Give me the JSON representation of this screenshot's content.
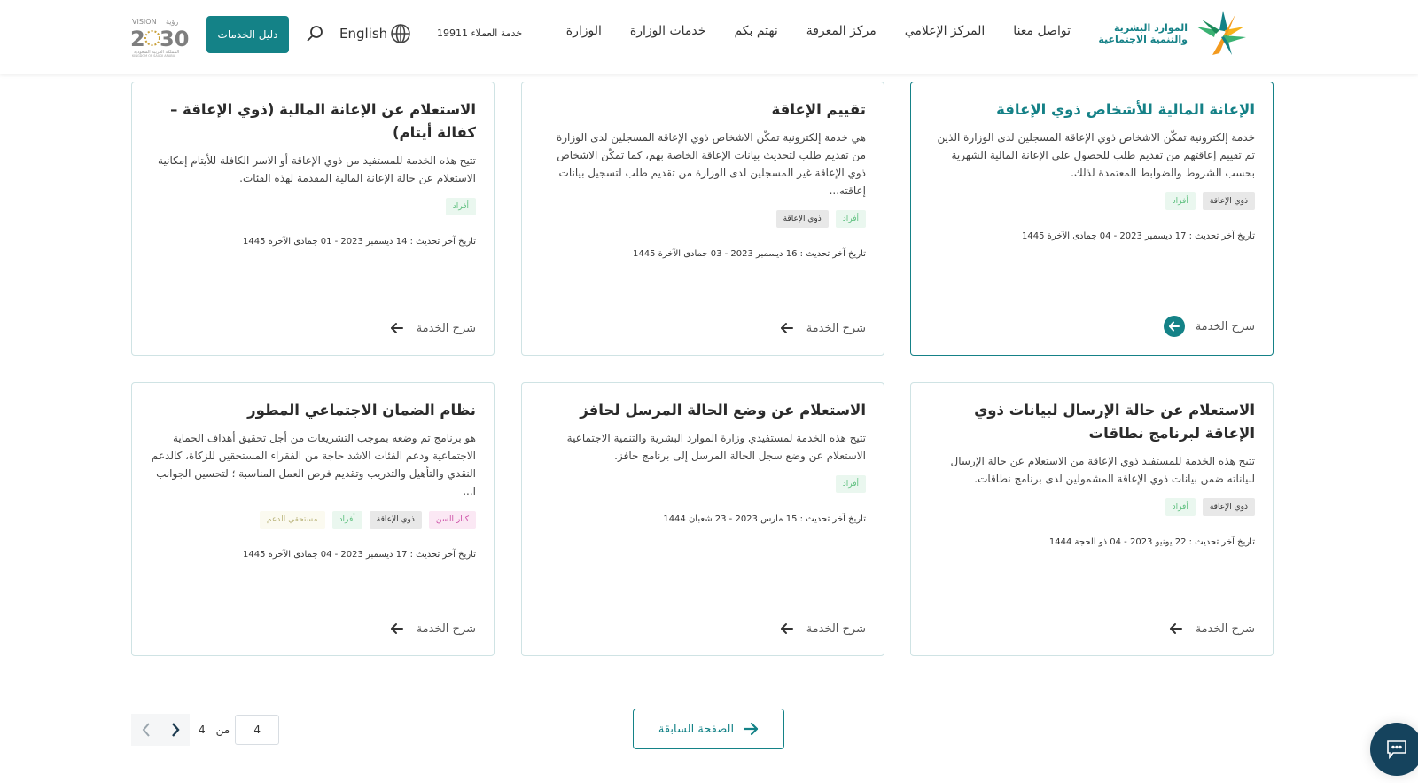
{
  "header": {
    "logo_line1": "الموارد البشرية",
    "logo_line2": "والتنمية الاجتماعية",
    "nav": [
      "الوزارة",
      "خدمات الوزارة",
      "نهتم بكم",
      "مركز المعرفة",
      "المركز الإعلامي",
      "تواصل معنا"
    ],
    "customer_service": "خدمة العملاء 19911",
    "language": "English",
    "services_guide": "دليل الخدمات",
    "vision_label": "VISION 2030"
  },
  "cards": [
    {
      "title": "الإعانة المالية للأشخاص ذوي الإعاقة",
      "description": "خدمة إلكترونية تمكّن الاشخاص ذوي الإعاقة المسجلين لدى الوزارة الذين تم تقييم إعاقتهم من تقديم طلب للحصول على الإعانة المالية الشهرية بحسب الشروط والضوابط المعتمدة لذلك.",
      "tags": [
        "ذوي الإعاقة",
        "أفراد"
      ],
      "date": "تاريخ آخر تحديث : 17 ديسمبر 2023 - 04 جمادى الآخرة 1445",
      "link": "شرح الخدمة",
      "active": true
    },
    {
      "title": "تقييم الإعاقة",
      "description": "هي خدمة إلكترونية تمكّن الاشخاص ذوي الإعاقة المسجلين لدى الوزارة من تقديم طلب لتحديث بيانات الإعاقة الخاصة بهم، كما تمكّن الاشخاص ذوي الإعاقة غير المسجلين لدى الوزارة من تقديم طلب لتسجيل بيانات إعاقته...",
      "tags": [
        "أفراد",
        "ذوي الإعاقة"
      ],
      "date": "تاريخ آخر تحديث : 16 ديسمبر 2023 - 03 جمادى الآخرة 1445",
      "link": "شرح الخدمة",
      "active": false
    },
    {
      "title": "الاستعلام عن الإعانة المالية (ذوي الإعاقة – كفالة أيتام)",
      "description": "تتيح هذه الخدمة للمستفيد من ذوي الإعاقة أو الاسر الكافلة للأيتام إمكانية الاستعلام عن حالة الإعانة المالية المقدمة لهذه الفئات.",
      "tags": [
        "أفراد"
      ],
      "date": "تاريخ آخر تحديث : 14 ديسمبر 2023 - 01 جمادى الآخرة 1445",
      "link": "شرح الخدمة",
      "active": false
    },
    {
      "title": "الاستعلام عن حالة الإرسال لبيانات ذوي الإعاقة لبرنامج نطاقات",
      "description": "تتيح هذه الخدمة للمستفيد ذوي الإعاقة من الاستعلام عن حالة الإرسال لبياناته ضمن بيانات ذوي الإعاقة المشمولين لدى برنامج نطاقات.",
      "tags": [
        "ذوي الإعاقة",
        "أفراد"
      ],
      "date": "تاريخ آخر تحديث : 22 يونيو 2023 - 04 ذو الحجة 1444",
      "link": "شرح الخدمة",
      "active": false
    },
    {
      "title": "الاستعلام عن وضع الحالة المرسل لحافز",
      "description": "تتيح هذه الخدمة لمستفيدي وزارة الموارد البشرية والتنمية الاجتماعية الاستعلام عن وضع سجل الحالة المرسل إلى برنامج حافز.",
      "tags": [
        "أفراد"
      ],
      "date": "تاريخ آخر تحديث : 15 مارس 2023 - 23 شعبان 1444",
      "link": "شرح الخدمة",
      "active": false
    },
    {
      "title": "نظام الضمان الاجتماعي المطور",
      "description": "هو برنامج تم وضعه بموجب التشريعات من أجل تحقيق أهداف الحماية الاجتماعية ودعم الفئات الاشد حاجة من الفقراء المستحقين للزكاة، كالدعم النقدي والتأهيل والتدريب وتقديم فرص العمل المناسبة ؛ لتحسين الجوانب ا...",
      "tags": [
        "كبار السن",
        "ذوي الإعاقة",
        "أفراد",
        "مستحقي الدعم"
      ],
      "date": "تاريخ آخر تحديث : 17 ديسمبر 2023 - 04 جمادى الآخرة 1445",
      "link": "شرح الخدمة",
      "active": false
    }
  ],
  "pagination": {
    "previous_label": "الصفحة السابقة",
    "current_page": "4",
    "of_label": "من",
    "total_pages": "4"
  },
  "tag_styles": {
    "ذوي الإعاقة": "disability",
    "أفراد": "individuals",
    "كبار السن": "elderly",
    "مستحقي الدعم": "support"
  },
  "colors": {
    "brand_teal": "#148287",
    "chat_navy": "#15435d"
  }
}
